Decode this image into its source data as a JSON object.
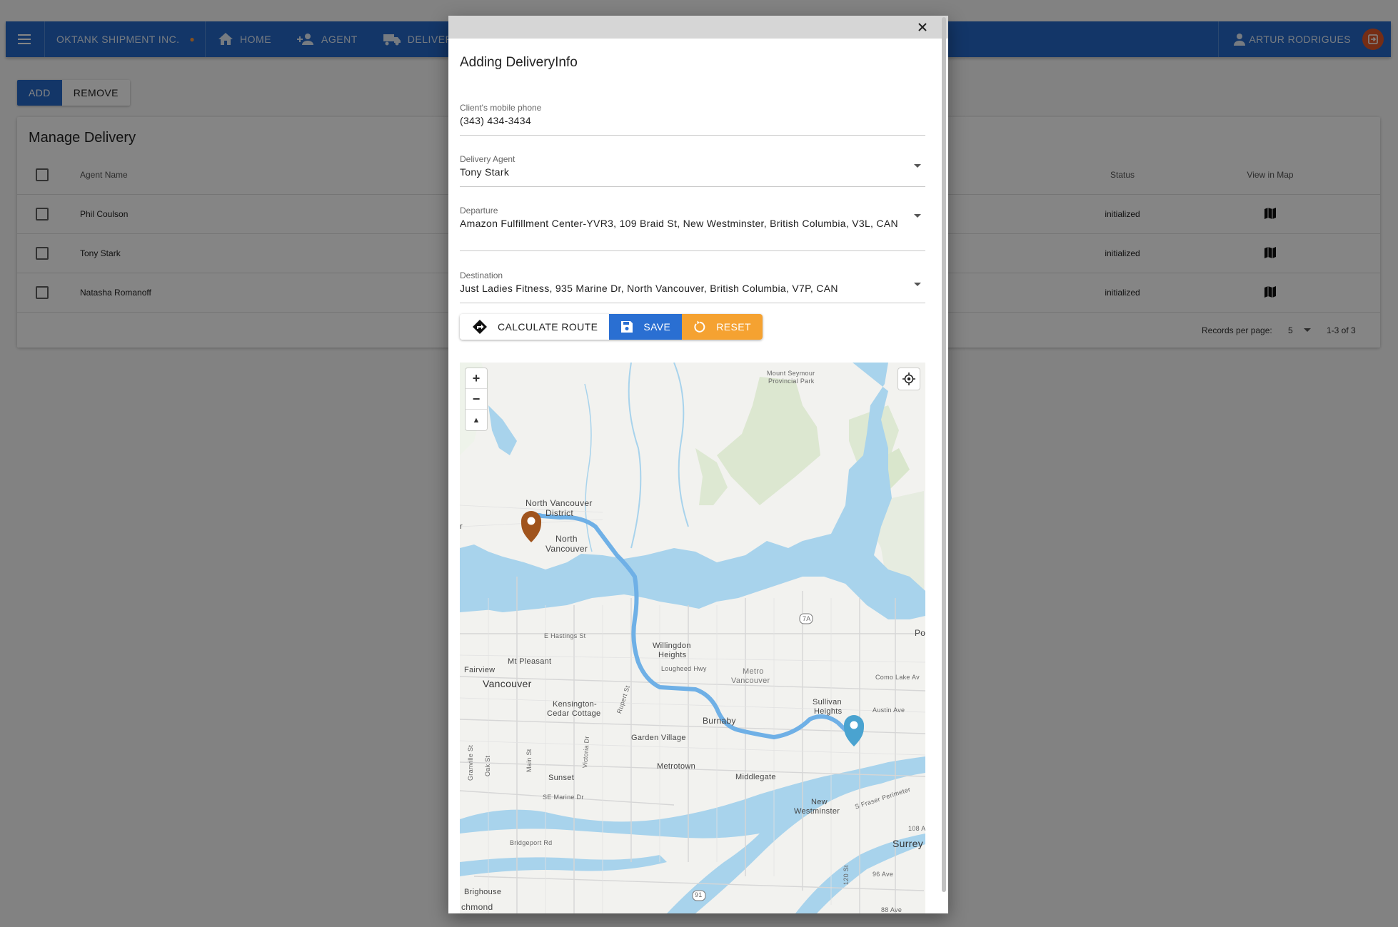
{
  "appbar": {
    "brand": "OKTANK SHIPMENT INC.",
    "nav": [
      {
        "label": "HOME",
        "icon": "home-icon"
      },
      {
        "label": "AGENT",
        "icon": "add-person-icon"
      },
      {
        "label": "DELIVERY",
        "icon": "truck-icon"
      }
    ],
    "user": "ARTUR RODRIGUES",
    "colors": {
      "bar": "#2568c7",
      "logout": "#e0562a"
    }
  },
  "actions": {
    "add": "ADD",
    "remove": "REMOVE"
  },
  "panel": {
    "title": "Manage Delivery",
    "headers": {
      "agent": "Agent Name",
      "status": "Status",
      "map": "View in Map"
    },
    "rows": [
      {
        "agent": "Phil Coulson",
        "status": "initialized"
      },
      {
        "agent": "Tony Stark",
        "status": "initialized"
      },
      {
        "agent": "Natasha Romanoff",
        "status": "initialized"
      }
    ],
    "footer": {
      "per_page_label": "Records per page:",
      "per_page": "5",
      "range": "1-3 of 3"
    }
  },
  "modal": {
    "title": "Adding DeliveryInfo",
    "fields": {
      "phone": {
        "label": "Client's mobile phone",
        "value": "(343) 434-3434"
      },
      "agent": {
        "label": "Delivery Agent",
        "value": "Tony Stark"
      },
      "departure": {
        "label": "Departure",
        "value": "Amazon Fulfillment Center-YVR3, 109 Braid St, New Westminster, British Columbia, V3L, CAN"
      },
      "destination": {
        "label": "Destination",
        "value": "Just Ladies Fitness, 935 Marine Dr, North Vancouver, British Columbia, V7P, CAN"
      }
    },
    "buttons": {
      "calculate": "CALCULATE ROUTE",
      "save": "SAVE",
      "reset": "RESET"
    },
    "button_colors": {
      "save": "#2a6fd2",
      "reset": "#f5a231"
    }
  },
  "map": {
    "labels": {
      "mount_seymour": "Mount Seymour",
      "provincial_park": "Provincial Park",
      "nv_district_1": "North Vancouver",
      "nv_district_2": "District",
      "nv_city_1": "North",
      "nv_city_2": "Vancouver",
      "hwy_7a": "7A",
      "po": "Po",
      "hastings": "E Hastings St",
      "willingdon_1": "Willingdon",
      "willingdon_2": "Heights",
      "lougheed": "Lougheed Hwy",
      "metro_1": "Metro",
      "metro_2": "Vancouver",
      "mt_pleasant": "Mt Pleasant",
      "fairview": "Fairview",
      "vancouver": "Vancouver",
      "como_lake": "Como Lake Av",
      "sullivan_1": "Sullivan",
      "sullivan_2": "Heights",
      "austin": "Austin Ave",
      "kensington_1": "Kensington-",
      "kensington_2": "Cedar Cottage",
      "rupert": "Rupert St",
      "burnaby": "Burnaby",
      "garden_village": "Garden Village",
      "granville": "Granville St",
      "oak": "Oak St",
      "main": "Main St",
      "victoria": "Victoria Dr",
      "metrotown": "Metrotown",
      "middlegate": "Middlegate",
      "sunset": "Sunset",
      "se_marine": "SE Marine Dr",
      "new_west_1": "New",
      "new_west_2": "Westminster",
      "fraser": "S Fraser Perimeter",
      "bridgeport": "Bridgeport Rd",
      "ave_108": "108 A",
      "surrey": "Surrey",
      "st_120": "120 St",
      "ave_96": "96 Ave",
      "hwy_91": "91",
      "brighouse": "Brighouse",
      "richmond": "chmond",
      "ave_88": "88 Ave",
      "edge_r": "r"
    },
    "marker_colors": {
      "destination": "#a0541d",
      "departure": "#4aa3d0"
    },
    "route_color": "#6fb0e6"
  }
}
